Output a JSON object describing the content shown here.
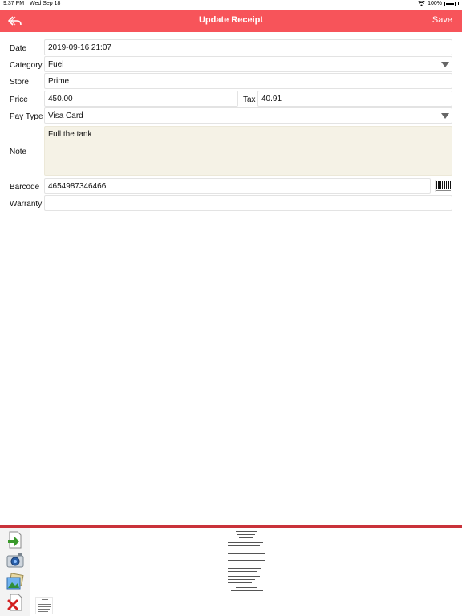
{
  "status": {
    "time": "9:37 PM",
    "date": "Wed Sep 18",
    "battery": "100%"
  },
  "navbar": {
    "title": "Update Receipt",
    "save_label": "Save",
    "back_icon": "reply-arrow-icon"
  },
  "form": {
    "date_label": "Date",
    "date_value": "2019-09-16 21:07",
    "category_label": "Category",
    "category_value": "Fuel",
    "store_label": "Store",
    "store_value": "Prime",
    "price_label": "Price",
    "price_value": "450.00",
    "tax_label": "Tax",
    "tax_value": "40.91",
    "paytype_label": "Pay Type",
    "paytype_value": "Visa Card",
    "note_label": "Note",
    "note_value": "Full the tank",
    "barcode_label": "Barcode",
    "barcode_value": "4654987346466",
    "warranty_label": "Warranty",
    "warranty_value": ""
  },
  "colors": {
    "navbar": "#f7545a",
    "note_background": "#f5f2e6",
    "bottom_accent": "#c9323a"
  },
  "toolbar_icons": [
    "import-icon",
    "camera-icon",
    "photo-library-icon",
    "delete-icon"
  ]
}
